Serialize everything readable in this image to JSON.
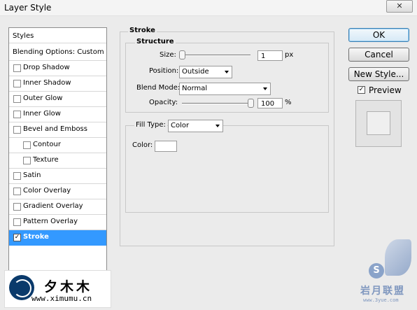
{
  "window": {
    "title": "Layer Style",
    "close_glyph": "✕"
  },
  "styles_list": {
    "header": "Styles",
    "blending": "Blending Options: Custom",
    "effects": [
      {
        "label": "Drop Shadow",
        "checked": false
      },
      {
        "label": "Inner Shadow",
        "checked": false
      },
      {
        "label": "Outer Glow",
        "checked": false
      },
      {
        "label": "Inner Glow",
        "checked": false
      },
      {
        "label": "Bevel and Emboss",
        "checked": false
      },
      {
        "label": "Contour",
        "checked": false
      },
      {
        "label": "Texture",
        "checked": false
      },
      {
        "label": "Satin",
        "checked": false
      },
      {
        "label": "Color Overlay",
        "checked": false
      },
      {
        "label": "Gradient Overlay",
        "checked": false
      },
      {
        "label": "Pattern Overlay",
        "checked": false
      },
      {
        "label": "Stroke",
        "checked": true
      }
    ],
    "checkmark": "✓"
  },
  "stroke": {
    "title": "Stroke",
    "structure_title": "Structure",
    "size_label": "Size:",
    "size_value": "1",
    "size_unit": "px",
    "position_label": "Position:",
    "position_value": "Outside",
    "blend_label": "Blend Mode:",
    "blend_value": "Normal",
    "opacity_label": "Opacity:",
    "opacity_value": "100",
    "opacity_unit": "%",
    "fill_type_label": "Fill Type:",
    "fill_type_value": "Color",
    "color_label": "Color:",
    "color_value": "#ffffff"
  },
  "buttons": {
    "ok": "OK",
    "cancel": "Cancel",
    "new_style": "New Style...",
    "preview_label": "Preview",
    "preview_checked": true
  },
  "watermark_left": {
    "cn": "夕木木",
    "url": "www.ximumu.cn"
  },
  "watermark_right": {
    "letter": "S",
    "cn": "岩月联盟",
    "url": "www.3yue.com"
  }
}
